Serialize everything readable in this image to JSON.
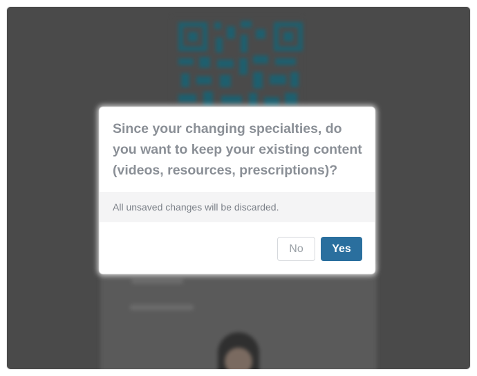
{
  "dialog": {
    "title": "Since your changing specialties, do you want to keep your existing content (videos, resources, prescriptions)?",
    "message": "All unsaved changes will be discarded.",
    "no_label": "No",
    "yes_label": "Yes"
  },
  "colors": {
    "overlay": "#4a4a4a",
    "primary_button": "#2a6f9e",
    "title_text": "#8a8f96",
    "body_background": "#f4f4f5",
    "qr_code": "#1e5f6e"
  },
  "icons": {
    "background_qr": "qr-code-icon",
    "background_avatar": "avatar"
  }
}
